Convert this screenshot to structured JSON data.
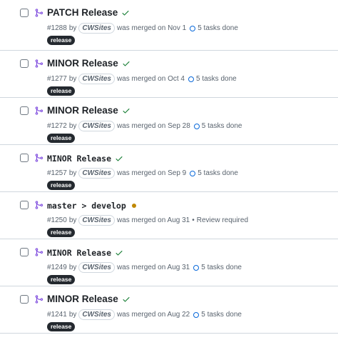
{
  "pull_requests": [
    {
      "title": "PATCH Release",
      "mono": false,
      "status_icon": "check-icon",
      "number": "#1288",
      "by": "by",
      "author": "CWSites",
      "merged": "was merged on Nov 1",
      "tasks_icon": "task-progress-icon",
      "tasks": "5 tasks done",
      "label": "release"
    },
    {
      "title": "MINOR Release",
      "mono": false,
      "status_icon": "check-icon",
      "number": "#1277",
      "by": "by",
      "author": "CWSites",
      "merged": "was merged on Oct 4",
      "tasks_icon": "task-progress-icon",
      "tasks": "5 tasks done",
      "label": "release"
    },
    {
      "title": "MINOR Release",
      "mono": false,
      "status_icon": "check-icon",
      "number": "#1272",
      "by": "by",
      "author": "CWSites",
      "merged": "was merged on Sep 28",
      "tasks_icon": "task-progress-icon",
      "tasks": "5 tasks done",
      "label": "release"
    },
    {
      "title": "MINOR Release",
      "mono": true,
      "status_icon": "check-icon",
      "number": "#1257",
      "by": "by",
      "author": "CWSites",
      "merged": "was merged on Sep 9",
      "tasks_icon": "task-progress-icon",
      "tasks": "5 tasks done",
      "label": "release"
    },
    {
      "title": "master > develop",
      "mono": true,
      "status_icon": "pending-dot-icon",
      "number": "#1250",
      "by": "by",
      "author": "CWSites",
      "merged": "was merged on Aug 31",
      "review": "Review required",
      "label": "release"
    },
    {
      "title": "MINOR Release",
      "mono": true,
      "status_icon": "check-icon",
      "number": "#1249",
      "by": "by",
      "author": "CWSites",
      "merged": "was merged on Aug 31",
      "tasks_icon": "task-progress-icon",
      "tasks": "5 tasks done",
      "label": "release"
    },
    {
      "title": "MINOR Release",
      "mono": false,
      "status_icon": "check-icon",
      "number": "#1241",
      "by": "by",
      "author": "CWSites",
      "merged": "was merged on Aug 22",
      "tasks_icon": "task-progress-icon",
      "tasks": "5 tasks done",
      "label": "release"
    }
  ],
  "colors": {
    "merged_icon": "#8250df",
    "check": "#1a7f37",
    "pending": "#bf8700",
    "task": "#0969da",
    "label_bg": "#24292f"
  }
}
